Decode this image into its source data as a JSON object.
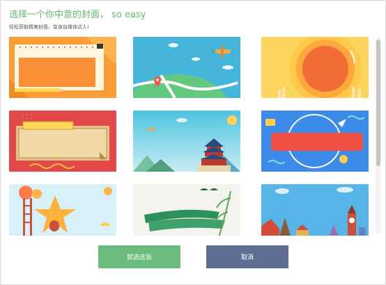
{
  "dialog": {
    "title": "选择一个你中意的封面， so easy",
    "subtitle": "轻松获取精美封面，变身自媒体达人!"
  },
  "covers": [
    {
      "name": "orange-notepad"
    },
    {
      "name": "map-airplane"
    },
    {
      "name": "orange-sun"
    },
    {
      "name": "red-banner"
    },
    {
      "name": "temple-of-heaven"
    },
    {
      "name": "blue-circle"
    },
    {
      "name": "star-house"
    },
    {
      "name": "green-brushstroke"
    },
    {
      "name": "landmarks"
    }
  ],
  "actions": {
    "confirm_label": "就选这张",
    "cancel_label": "取消"
  }
}
